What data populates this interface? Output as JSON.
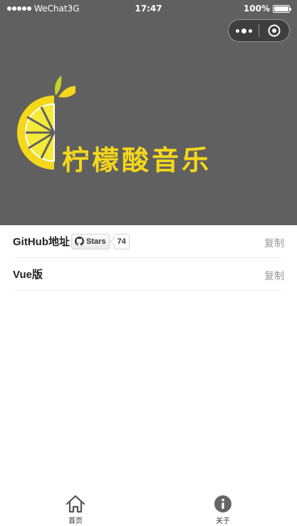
{
  "status_bar": {
    "carrier": "WeChat3G",
    "time": "17:47",
    "battery": "100%",
    "battery_level": 1.0
  },
  "capsule": {
    "more_icon": "more-dots-icon",
    "close_icon": "target-icon"
  },
  "banner": {
    "brand_text": "柠檬酸音乐",
    "logo": "lemon-slice-logo",
    "logo_color": "#f5d71b",
    "background": "#606060"
  },
  "list": {
    "items": [
      {
        "label": "GitHub地址",
        "badge": {
          "icon": "github-icon",
          "text": "Stars",
          "count": "74"
        },
        "action": "复制"
      },
      {
        "label": "Vue版",
        "action": "复制"
      }
    ]
  },
  "tabbar": {
    "tabs": [
      {
        "label": "首页",
        "icon": "home-icon"
      },
      {
        "label": "关于",
        "icon": "info-icon"
      }
    ]
  }
}
